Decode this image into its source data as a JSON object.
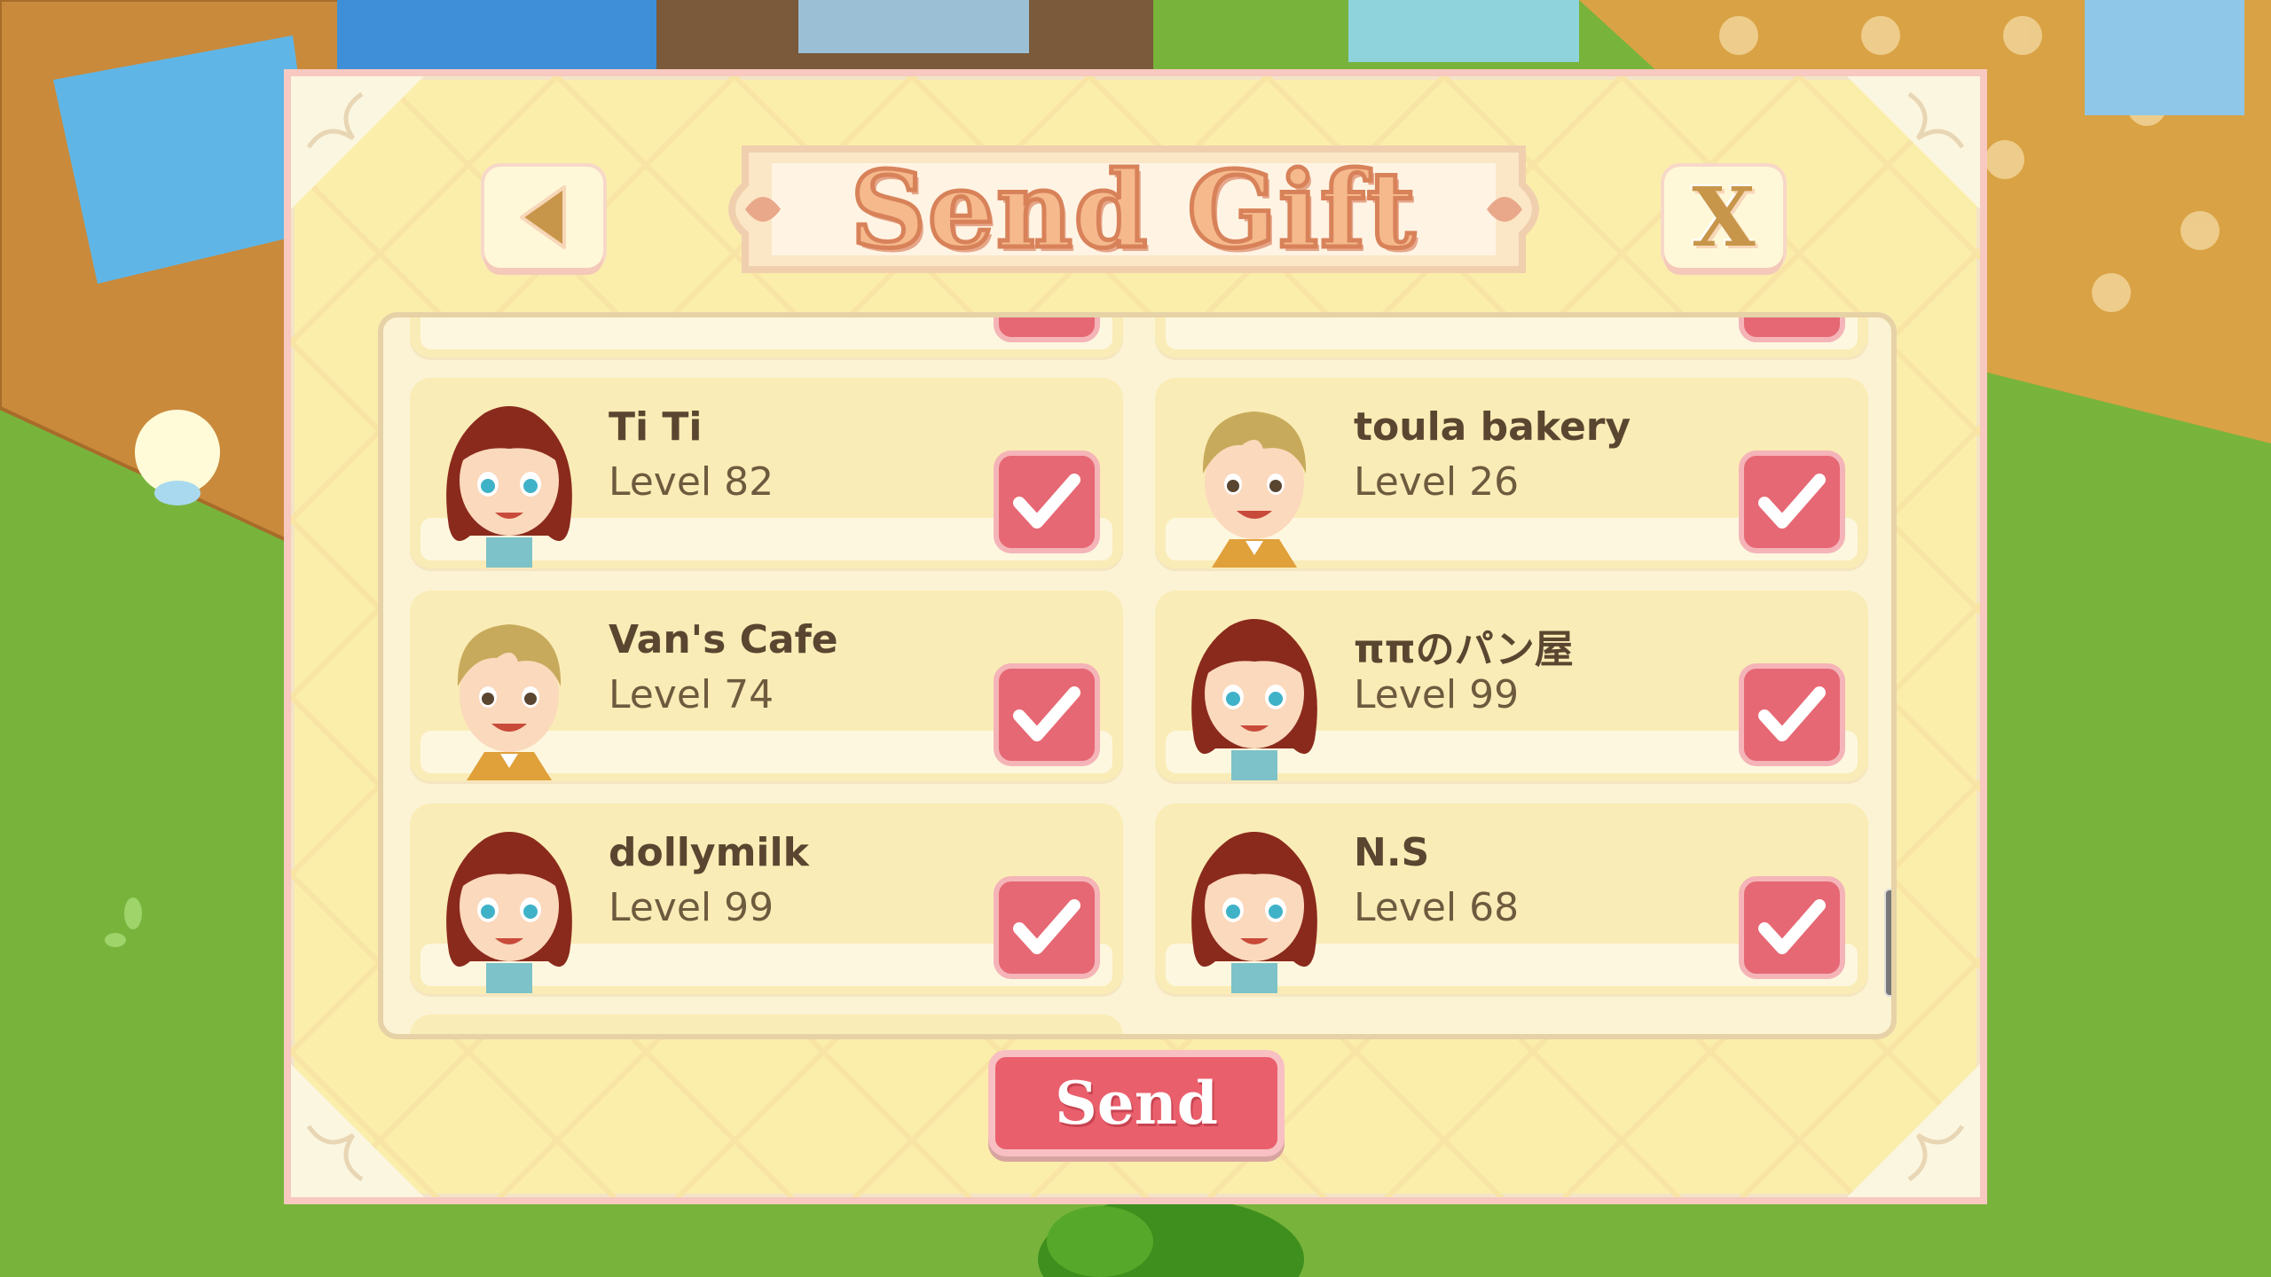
{
  "dialog": {
    "title": "Send Gift",
    "close_label": "X",
    "send_label": "Send"
  },
  "friends": [
    {
      "name": "Ti Ti",
      "level": "Level 82",
      "avatar": "girl-avatar",
      "selected": true
    },
    {
      "name": "toula bakery",
      "level": "Level 26",
      "avatar": "boy-avatar",
      "selected": true
    },
    {
      "name": "Van's Cafe",
      "level": "Level 74",
      "avatar": "boy-avatar",
      "selected": true
    },
    {
      "name": "ππのパン屋",
      "level": "Level 99",
      "avatar": "girl-avatar",
      "selected": true
    },
    {
      "name": "dollymilk",
      "level": "Level 99",
      "avatar": "girl-avatar",
      "selected": true
    },
    {
      "name": "N.S",
      "level": "Level 68",
      "avatar": "girl-avatar",
      "selected": true
    }
  ],
  "colors": {
    "dialog_bg": "#fbeeab",
    "checkbox_checked": "#e66874",
    "send_button": "#ea5f6c",
    "title_text": "#f5b98c"
  }
}
